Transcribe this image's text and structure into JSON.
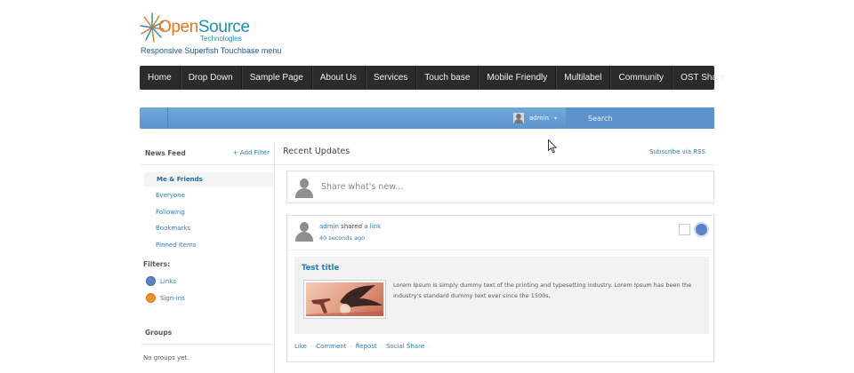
{
  "site": {
    "logo_main_open": "Open",
    "logo_main_source": "Source",
    "logo_sub": "Technologies",
    "description": "Responsive Superfish Touchbase menu"
  },
  "menu": {
    "items": [
      {
        "label": "Home"
      },
      {
        "label": "Drop Down"
      },
      {
        "label": "Sample Page"
      },
      {
        "label": "About Us"
      },
      {
        "label": "Services"
      },
      {
        "label": "Touch base"
      },
      {
        "label": "Mobile Friendly"
      },
      {
        "label": "Multilabel"
      },
      {
        "label": "Community"
      },
      {
        "label": "OST Share"
      }
    ]
  },
  "adminbar": {
    "user_name": "admin",
    "caret": "▾",
    "search_placeholder": "Search"
  },
  "sidebar": {
    "news_feed_heading": "News Feed",
    "add_filter": "+ Add Filter",
    "feeds": [
      {
        "label": "Me & Friends",
        "active": true
      },
      {
        "label": "Everyone"
      },
      {
        "label": "Following"
      },
      {
        "label": "Bookmarks"
      },
      {
        "label": "Pinned Items"
      }
    ],
    "filters_label": "Filters:",
    "filters": [
      {
        "label": "Links",
        "color": "#5b83c9"
      },
      {
        "label": "Sign-ins",
        "color": "#f0922a"
      }
    ],
    "groups_heading": "Groups",
    "no_groups": "No groups yet."
  },
  "main": {
    "title": "Recent Updates",
    "rss_link": "Subscribe via RSS",
    "share_placeholder": "Share what's new...",
    "post": {
      "author": "admin",
      "verb": "shared",
      "object": "a link",
      "time": "40 seconds ago",
      "excerpt_title": "Test title",
      "excerpt_text": "Lorem Ipsum is simply dummy text of the printing and typesetting industry. Lorem Ipsum has been the industry's standard dummy text ever since the 1500s,",
      "actions": [
        {
          "label": "Like"
        },
        {
          "label": "Comment"
        },
        {
          "label": "Repost"
        },
        {
          "label": "Social Share"
        }
      ],
      "separator": "·"
    }
  },
  "colors": {
    "link": "#2a7bbf",
    "menubar": "#2b2b2b",
    "adminbar": "#5b95cf",
    "logo_orange": "#e2761d",
    "logo_blue": "#1f8fbd"
  }
}
